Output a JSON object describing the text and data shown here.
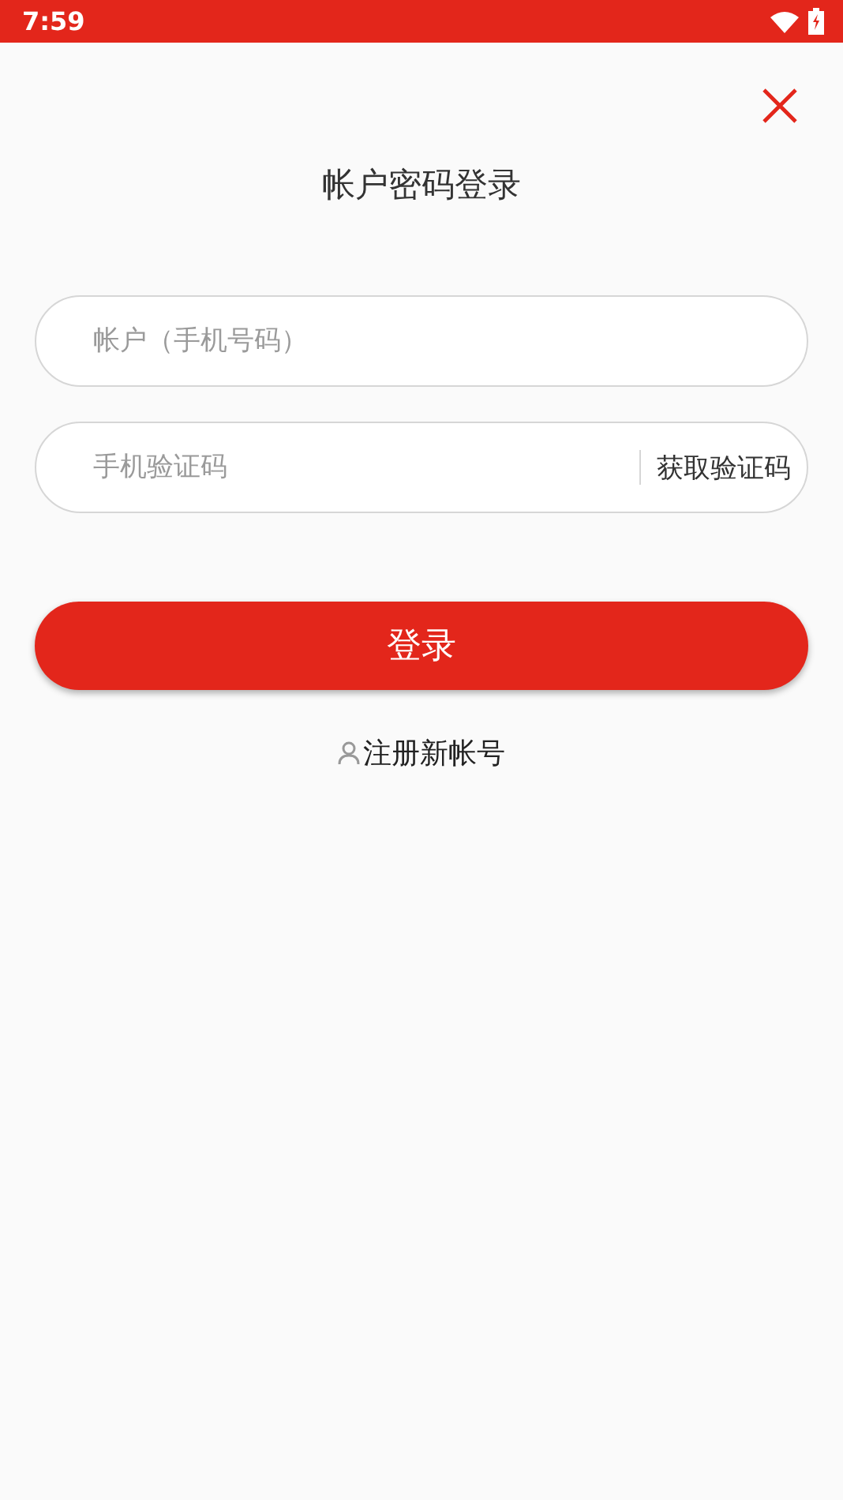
{
  "status_bar": {
    "time": "7:59"
  },
  "title": "帐户密码登录",
  "account_field": {
    "placeholder": "帐户（手机号码）"
  },
  "code_field": {
    "placeholder": "手机验证码",
    "action": "获取验证码"
  },
  "login_button": "登录",
  "register_link": "注册新帐号"
}
